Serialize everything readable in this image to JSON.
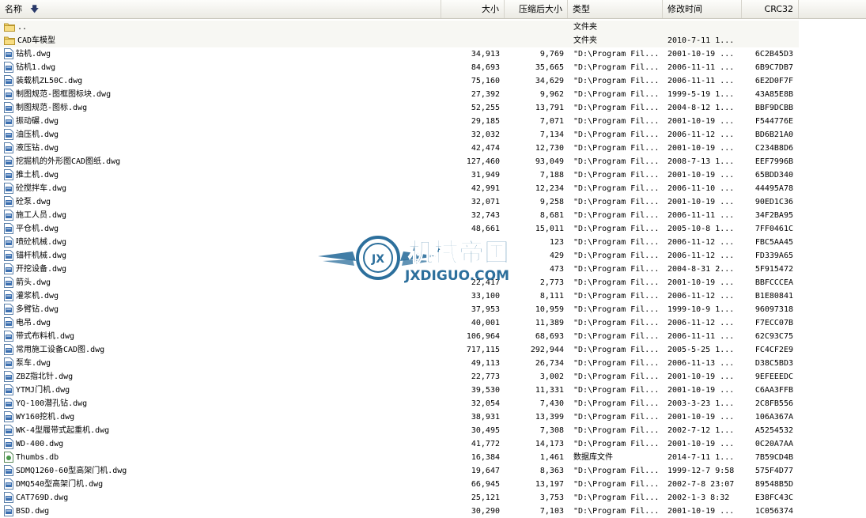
{
  "columns": {
    "name": "名称",
    "size": "大小",
    "compressed": "压缩后大小",
    "type": "类型",
    "modified": "修改时间",
    "crc": "CRC32"
  },
  "watermark": {
    "title": "机械帝国",
    "subtitle": "JXDIGUO.COM",
    "badge": "JX"
  },
  "rows": [
    {
      "icon": "folder-icon",
      "name": "..",
      "size": "",
      "compressed": "",
      "type": "文件夹",
      "modified": "",
      "crc": ""
    },
    {
      "icon": "folder-icon",
      "name": "CAD车模型",
      "size": "",
      "compressed": "",
      "type": "文件夹",
      "modified": "2010-7-11 1...",
      "crc": ""
    },
    {
      "icon": "dwg-file-icon",
      "name": "钻机.dwg",
      "size": "34,913",
      "compressed": "9,769",
      "type": "\"D:\\Program Fil...",
      "modified": "2001-10-19 ...",
      "crc": "6C2B45D3"
    },
    {
      "icon": "dwg-file-icon",
      "name": "钻机1.dwg",
      "size": "84,693",
      "compressed": "35,665",
      "type": "\"D:\\Program Fil...",
      "modified": "2006-11-11 ...",
      "crc": "6B9C7DB7"
    },
    {
      "icon": "dwg-file-icon",
      "name": "装载机ZL50C.dwg",
      "size": "75,160",
      "compressed": "34,629",
      "type": "\"D:\\Program Fil...",
      "modified": "2006-11-11 ...",
      "crc": "6E2D0F7F"
    },
    {
      "icon": "dwg-file-icon",
      "name": "制图规范-图框图标块.dwg",
      "size": "27,392",
      "compressed": "9,962",
      "type": "\"D:\\Program Fil...",
      "modified": "1999-5-19 1...",
      "crc": "43A85E8B"
    },
    {
      "icon": "dwg-file-icon",
      "name": "制图规范-图标.dwg",
      "size": "52,255",
      "compressed": "13,791",
      "type": "\"D:\\Program Fil...",
      "modified": "2004-8-12 1...",
      "crc": "BBF9DCBB"
    },
    {
      "icon": "dwg-file-icon",
      "name": "振动碾.dwg",
      "size": "29,185",
      "compressed": "7,071",
      "type": "\"D:\\Program Fil...",
      "modified": "2001-10-19 ...",
      "crc": "F544776E"
    },
    {
      "icon": "dwg-file-icon",
      "name": "油压机.dwg",
      "size": "32,032",
      "compressed": "7,134",
      "type": "\"D:\\Program Fil...",
      "modified": "2006-11-12 ...",
      "crc": "BD6B21A0"
    },
    {
      "icon": "dwg-file-icon",
      "name": "液压钻.dwg",
      "size": "42,474",
      "compressed": "12,730",
      "type": "\"D:\\Program Fil...",
      "modified": "2001-10-19 ...",
      "crc": "C234B8D6"
    },
    {
      "icon": "dwg-file-icon",
      "name": "挖掘机的外形图CAD图纸.dwg",
      "size": "127,460",
      "compressed": "93,049",
      "type": "\"D:\\Program Fil...",
      "modified": "2008-7-13 1...",
      "crc": "EEF7996B"
    },
    {
      "icon": "dwg-file-icon",
      "name": "推土机.dwg",
      "size": "31,949",
      "compressed": "7,188",
      "type": "\"D:\\Program Fil...",
      "modified": "2001-10-19 ...",
      "crc": "65BDD340"
    },
    {
      "icon": "dwg-file-icon",
      "name": "砼搅拌车.dwg",
      "size": "42,991",
      "compressed": "12,234",
      "type": "\"D:\\Program Fil...",
      "modified": "2006-11-10 ...",
      "crc": "44495A78"
    },
    {
      "icon": "dwg-file-icon",
      "name": "砼泵.dwg",
      "size": "32,071",
      "compressed": "9,258",
      "type": "\"D:\\Program Fil...",
      "modified": "2001-10-19 ...",
      "crc": "90ED1C36"
    },
    {
      "icon": "dwg-file-icon",
      "name": "施工人员.dwg",
      "size": "32,743",
      "compressed": "8,681",
      "type": "\"D:\\Program Fil...",
      "modified": "2006-11-11 ...",
      "crc": "34F2BA95"
    },
    {
      "icon": "dwg-file-icon",
      "name": "平仓机.dwg",
      "size": "48,661",
      "compressed": "15,011",
      "type": "\"D:\\Program Fil...",
      "modified": "2005-10-8 1...",
      "crc": "7FF0461C"
    },
    {
      "icon": "dwg-file-icon",
      "name": "喷砼机械.dwg",
      "size": "",
      "compressed": "123",
      "type": "\"D:\\Program Fil...",
      "modified": "2006-11-12 ...",
      "crc": "FBC5AA45"
    },
    {
      "icon": "dwg-file-icon",
      "name": "锚杆机械.dwg",
      "size": "",
      "compressed": "429",
      "type": "\"D:\\Program Fil...",
      "modified": "2006-11-12 ...",
      "crc": "FD339A65"
    },
    {
      "icon": "dwg-file-icon",
      "name": "开挖设备.dwg",
      "size": "",
      "compressed": "473",
      "type": "\"D:\\Program Fil...",
      "modified": "2004-8-31 2...",
      "crc": "5F915472"
    },
    {
      "icon": "dwg-file-icon",
      "name": "箭头.dwg",
      "size": "22,417",
      "compressed": "2,773",
      "type": "\"D:\\Program Fil...",
      "modified": "2001-10-19 ...",
      "crc": "BBFCCCEA"
    },
    {
      "icon": "dwg-file-icon",
      "name": "灌浆机.dwg",
      "size": "33,100",
      "compressed": "8,111",
      "type": "\"D:\\Program Fil...",
      "modified": "2006-11-12 ...",
      "crc": "B1E80841"
    },
    {
      "icon": "dwg-file-icon",
      "name": "多臂钻.dwg",
      "size": "37,953",
      "compressed": "10,959",
      "type": "\"D:\\Program Fil...",
      "modified": "1999-10-9 1...",
      "crc": "96097318"
    },
    {
      "icon": "dwg-file-icon",
      "name": "电吊.dwg",
      "size": "40,001",
      "compressed": "11,389",
      "type": "\"D:\\Program Fil...",
      "modified": "2006-11-12 ...",
      "crc": "F7ECC07B"
    },
    {
      "icon": "dwg-file-icon",
      "name": "带式布料机.dwg",
      "size": "106,964",
      "compressed": "68,693",
      "type": "\"D:\\Program Fil...",
      "modified": "2006-11-11 ...",
      "crc": "62C93C75"
    },
    {
      "icon": "dwg-file-icon",
      "name": "常用施工设备CAD图.dwg",
      "size": "717,115",
      "compressed": "292,944",
      "type": "\"D:\\Program Fil...",
      "modified": "2005-5-25 1...",
      "crc": "FC4CF2E9"
    },
    {
      "icon": "dwg-file-icon",
      "name": "泵车.dwg",
      "size": "49,113",
      "compressed": "26,734",
      "type": "\"D:\\Program Fil...",
      "modified": "2006-11-13 ...",
      "crc": "D38C5BD3"
    },
    {
      "icon": "dwg-file-icon",
      "name": "ZBZ指北针.dwg",
      "size": "22,773",
      "compressed": "3,002",
      "type": "\"D:\\Program Fil...",
      "modified": "2001-10-19 ...",
      "crc": "9EFEEEDC"
    },
    {
      "icon": "dwg-file-icon",
      "name": "YTMJ门机.dwg",
      "size": "39,530",
      "compressed": "11,331",
      "type": "\"D:\\Program Fil...",
      "modified": "2001-10-19 ...",
      "crc": "C6AA3FFB"
    },
    {
      "icon": "dwg-file-icon",
      "name": "YQ-100潜孔钻.dwg",
      "size": "32,054",
      "compressed": "7,430",
      "type": "\"D:\\Program Fil...",
      "modified": "2003-3-23 1...",
      "crc": "2C8FB556"
    },
    {
      "icon": "dwg-file-icon",
      "name": "WY160挖机.dwg",
      "size": "38,931",
      "compressed": "13,399",
      "type": "\"D:\\Program Fil...",
      "modified": "2001-10-19 ...",
      "crc": "106A367A"
    },
    {
      "icon": "dwg-file-icon",
      "name": "WK-4型履带式起重机.dwg",
      "size": "30,495",
      "compressed": "7,308",
      "type": "\"D:\\Program Fil...",
      "modified": "2002-7-12 1...",
      "crc": "A5254532"
    },
    {
      "icon": "dwg-file-icon",
      "name": "WD-400.dwg",
      "size": "41,772",
      "compressed": "14,173",
      "type": "\"D:\\Program Fil...",
      "modified": "2001-10-19 ...",
      "crc": "0C20A7AA"
    },
    {
      "icon": "thumbs-db-icon",
      "name": "Thumbs.db",
      "size": "16,384",
      "compressed": "1,461",
      "type": "数据库文件",
      "modified": "2014-7-11 1...",
      "crc": "7B59CD4B"
    },
    {
      "icon": "dwg-file-icon",
      "name": "SDMQ1260-60型高架门机.dwg",
      "size": "19,647",
      "compressed": "8,363",
      "type": "\"D:\\Program Fil...",
      "modified": "1999-12-7 9:58",
      "crc": "575F4D77"
    },
    {
      "icon": "dwg-file-icon",
      "name": "DMQ540型高架门机.dwg",
      "size": "66,945",
      "compressed": "13,197",
      "type": "\"D:\\Program Fil...",
      "modified": "2002-7-8 23:07",
      "crc": "89548B5D"
    },
    {
      "icon": "dwg-file-icon",
      "name": "CAT769D.dwg",
      "size": "25,121",
      "compressed": "3,753",
      "type": "\"D:\\Program Fil...",
      "modified": "2002-1-3 8:32",
      "crc": "E38FC43C"
    },
    {
      "icon": "dwg-file-icon",
      "name": "BSD.dwg",
      "size": "30,290",
      "compressed": "7,103",
      "type": "\"D:\\Program Fil...",
      "modified": "2001-10-19 ...",
      "crc": "1C056374"
    }
  ]
}
